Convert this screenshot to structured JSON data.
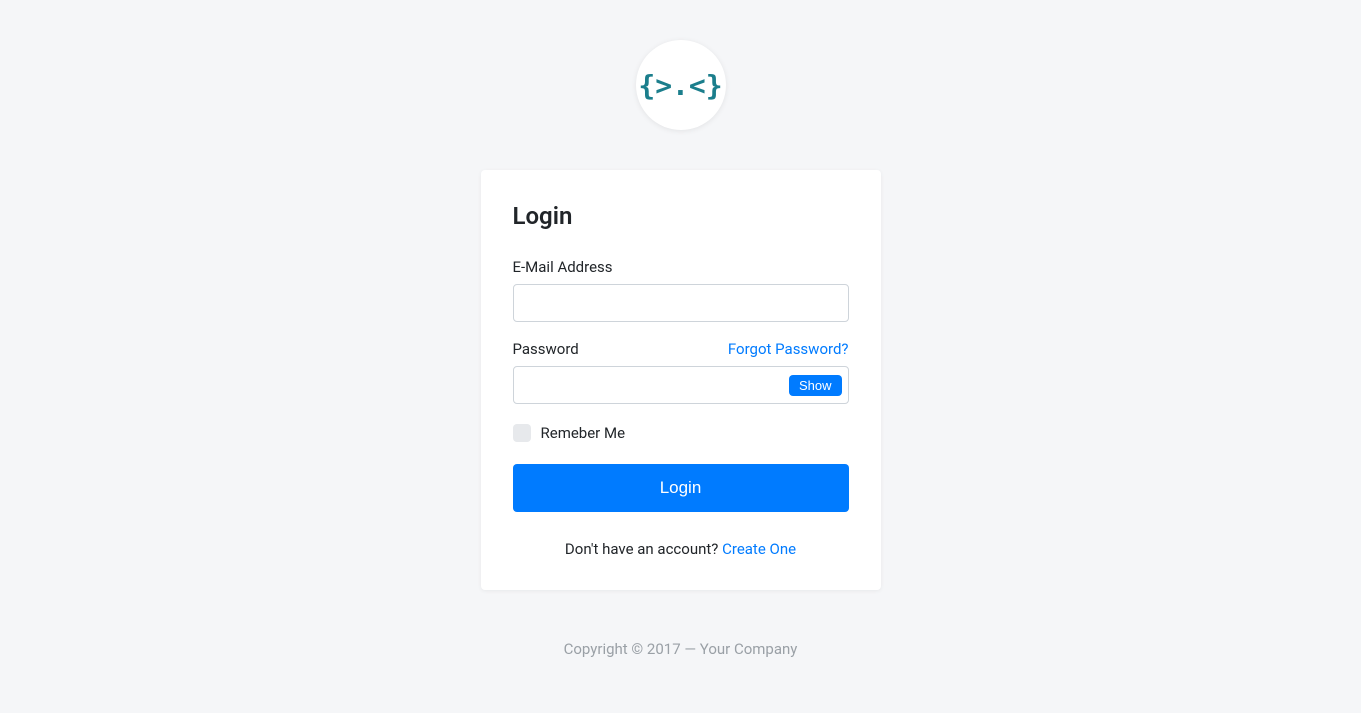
{
  "logo": {
    "glyph": "{>.<}"
  },
  "card": {
    "title": "Login",
    "email_label": "E-Mail Address",
    "email_value": "",
    "password_label": "Password",
    "forgot_link": "Forgot Password?",
    "password_value": "",
    "show_button": "Show",
    "remember_label": "Remeber Me",
    "login_button": "Login",
    "no_account_text": "Don't have an account? ",
    "create_link": "Create One"
  },
  "footer": {
    "text": "Copyright © 2017 — Your Company"
  }
}
